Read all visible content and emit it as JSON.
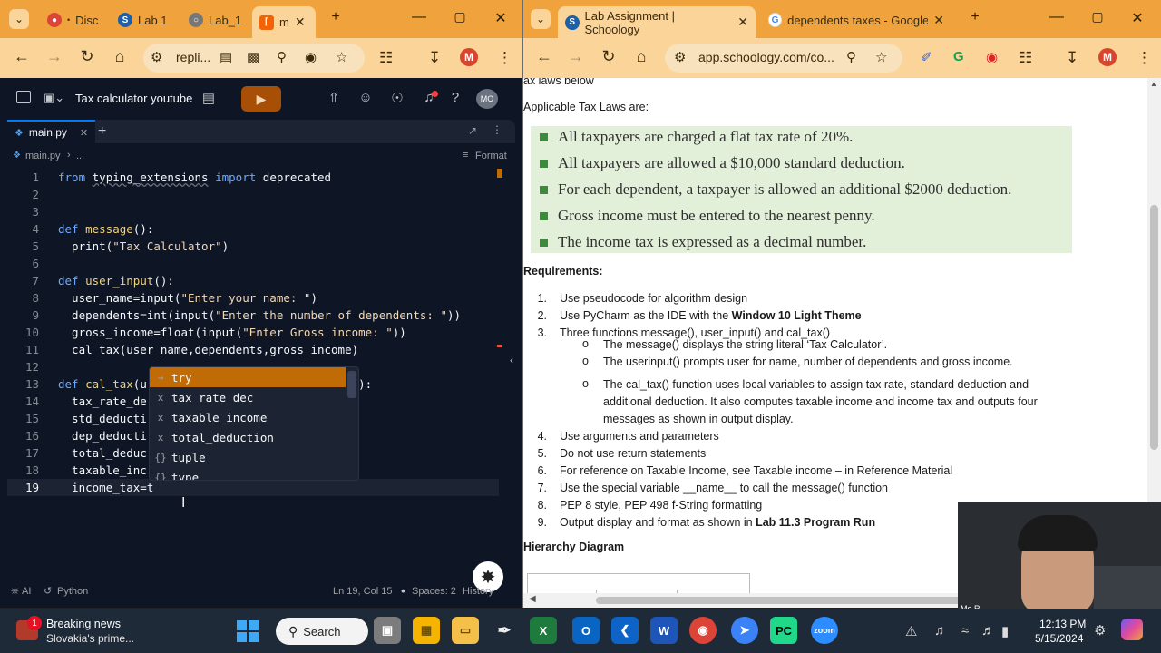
{
  "left_browser": {
    "tabs": [
      {
        "label": "Disc",
        "favicon": "chrome-icon",
        "color": "#db4437"
      },
      {
        "label": "Lab 1",
        "favicon": "schoology-icon",
        "color": "#1d5fa8"
      },
      {
        "label": "Lab_1",
        "favicon": "globe-icon",
        "color": "#555"
      },
      {
        "label": "m",
        "favicon": "replit-icon",
        "color": "#f26207"
      }
    ],
    "address": "repli...",
    "profile_initial": "M"
  },
  "replit": {
    "project_title": "Tax calculator youtube",
    "run_label": "▶",
    "user_initials": "MO",
    "file_tab": "main.py",
    "breadcrumb_file": "main.py",
    "breadcrumb_more": "...",
    "format_label": "Format",
    "code_lines": [
      {
        "n": "1",
        "parts": [
          [
            "kw",
            "from "
          ],
          [
            "",
            ""
          ],
          [
            "u",
            "typing_extensions"
          ],
          [
            "kw",
            " import "
          ],
          [
            "",
            "deprecated"
          ]
        ]
      },
      {
        "n": "2",
        "parts": []
      },
      {
        "n": "3",
        "parts": []
      },
      {
        "n": "4",
        "parts": [
          [
            "kw",
            "def "
          ],
          [
            "fn",
            "message"
          ],
          [
            "",
            "():"
          ]
        ]
      },
      {
        "n": "5",
        "parts": [
          [
            "",
            "  print("
          ],
          [
            "str",
            "\"Tax Calculator\""
          ],
          [
            "",
            ")"
          ]
        ]
      },
      {
        "n": "6",
        "parts": []
      },
      {
        "n": "7",
        "parts": [
          [
            "kw",
            "def "
          ],
          [
            "fn",
            "user_input"
          ],
          [
            "",
            "():"
          ]
        ]
      },
      {
        "n": "8",
        "parts": [
          [
            "",
            "  user_name=input("
          ],
          [
            "str",
            "\"Enter your name: \""
          ],
          [
            "",
            ")"
          ]
        ]
      },
      {
        "n": "9",
        "parts": [
          [
            "",
            "  dependents=int(input("
          ],
          [
            "str",
            "\"Enter the number of dependents: \""
          ],
          [
            "",
            "))"
          ]
        ]
      },
      {
        "n": "10",
        "parts": [
          [
            "",
            "  gross_income=float(input("
          ],
          [
            "str",
            "\"Enter Gross income: \""
          ],
          [
            "",
            "))"
          ]
        ]
      },
      {
        "n": "11",
        "parts": [
          [
            "",
            "  cal_tax(user_name,dependents,gross_income)"
          ]
        ]
      },
      {
        "n": "12",
        "parts": []
      },
      {
        "n": "13",
        "parts": [
          [
            "kw",
            "def "
          ],
          [
            "fn",
            "cal_tax"
          ],
          [
            "",
            "(u                              e):"
          ]
        ]
      },
      {
        "n": "14",
        "parts": [
          [
            "",
            "  tax_rate_de"
          ]
        ]
      },
      {
        "n": "15",
        "parts": [
          [
            "",
            "  std_deducti"
          ]
        ]
      },
      {
        "n": "16",
        "parts": [
          [
            "",
            "  dep_deducti"
          ]
        ]
      },
      {
        "n": "17",
        "parts": [
          [
            "",
            "  total_deduc                           n"
          ]
        ]
      },
      {
        "n": "18",
        "parts": [
          [
            "",
            "  taxable_inc                           n"
          ]
        ]
      },
      {
        "n": "19",
        "parts": [
          [
            "",
            "  income_tax=t"
          ]
        ]
      }
    ],
    "autocomplete": [
      {
        "icon": "→",
        "label": "try"
      },
      {
        "icon": "x",
        "label": "tax_rate_dec"
      },
      {
        "icon": "x",
        "label": "taxable_income"
      },
      {
        "icon": "x",
        "label": "total_deduction"
      },
      {
        "icon": "{}",
        "label": "tuple"
      },
      {
        "icon": "{}",
        "label": "type"
      }
    ],
    "status": {
      "ai": "AI",
      "language": "Python",
      "position": "Ln 19, Col 15",
      "spaces": "Spaces: 2",
      "history": "History"
    }
  },
  "right_browser": {
    "tabs": [
      {
        "label": "Lab Assignment | Schoology",
        "favicon": "schoology-icon"
      },
      {
        "label": "dependents taxes - Google",
        "favicon": "google-icon"
      }
    ],
    "address": "app.schoology.com/co...",
    "profile_initial": "M"
  },
  "assignment": {
    "cut_heading": "ax laws below",
    "applicable_heading": "Applicable Tax Laws are:",
    "laws": [
      "All taxpayers are charged a flat tax rate of 20%.",
      "All taxpayers are allowed a $10,000 standard deduction.",
      "For each dependent, a taxpayer is allowed an additional $2000 deduction.",
      "Gross income must be entered to the nearest penny.",
      "The income tax is expressed as a decimal number."
    ],
    "requirements_heading": "Requirements:",
    "requirements": [
      {
        "n": "1.",
        "text": "Use pseudocode for algorithm design"
      },
      {
        "n": "2.",
        "text": "Use PyCharm as the IDE with the ",
        "bold": "Window 10 Light Theme"
      },
      {
        "n": "3.",
        "text": "Three functions message(), user_input() and cal_tax()"
      }
    ],
    "sub_requirements": [
      "The message() displays the string literal ‘Tax Calculator’.",
      "The userinput() prompts user for name, number of dependents and gross income.",
      "The cal_tax() function uses local variables to assign tax rate, standard deduction and",
      "additional deduction. It also computes taxable income and income tax and outputs four",
      "messages as shown in output display."
    ],
    "requirements_more": [
      {
        "n": "4.",
        "text": "Use arguments and parameters"
      },
      {
        "n": "5.",
        "text": "Do not use return statements"
      },
      {
        "n": "6.",
        "text": "For reference on Taxable Income, see Taxable income – in Reference Material"
      },
      {
        "n": "7.",
        "text": "Use the special variable __name__ to call the message() function"
      },
      {
        "n": "8.",
        "text": "PEP 8 style, PEP 498 f-String formatting"
      },
      {
        "n": "9.",
        "text": "Output display and format as shown in ",
        "bold": "Lab 11.3 Program Run"
      }
    ],
    "hierarchy_heading": "Hierarchy Diagram"
  },
  "webcam": {
    "name_tag": "Mo R"
  },
  "taskbar": {
    "news_title": "Breaking news",
    "news_sub": "Slovakia's prime...",
    "news_badge": "1",
    "search_label": "Search",
    "time": "12:13 PM",
    "date": "5/15/2024"
  }
}
